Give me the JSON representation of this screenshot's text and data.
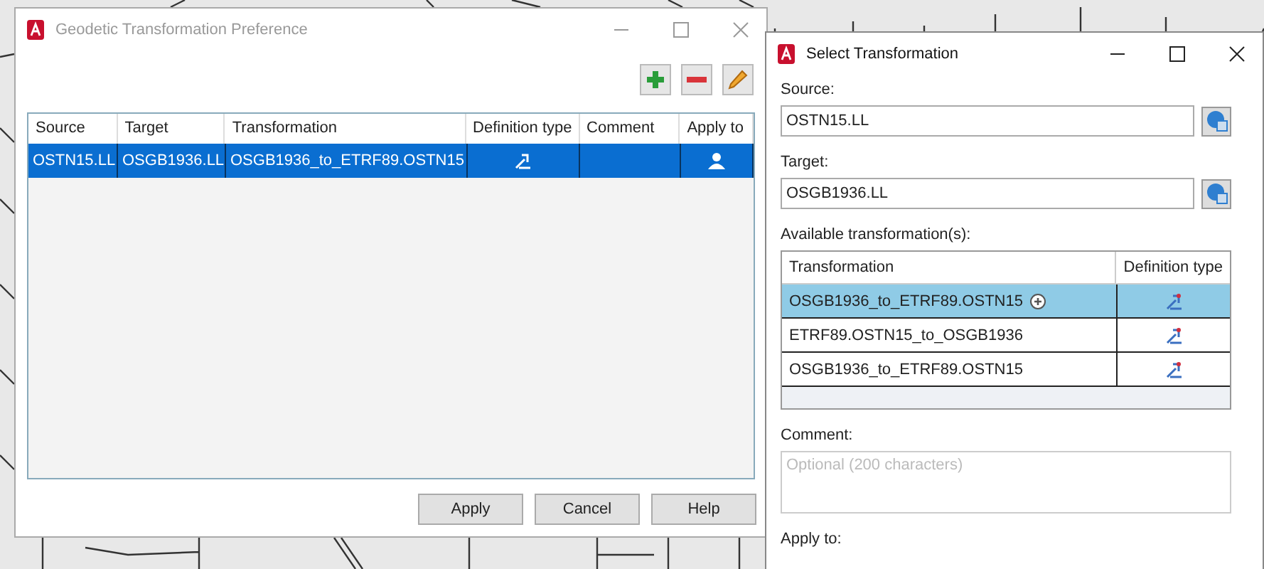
{
  "preference_window": {
    "title": "Geodetic Transformation Preference",
    "active": false,
    "columns": [
      "Source",
      "Target",
      "Transformation",
      "Definition type",
      "Comment",
      "Apply to"
    ],
    "rows": [
      {
        "source": "OSTN15.LL",
        "target": "OSGB1936.LL",
        "transformation": "OSGB1936_to_ETRF89.OSTN15",
        "selected": true
      }
    ],
    "buttons": [
      "Apply",
      "Cancel",
      "Help"
    ]
  },
  "select_window": {
    "title": "Select Transformation",
    "active": true,
    "source_label": "Source:",
    "source_value": "OSTN15.LL",
    "target_label": "Target:",
    "target_value": "OSGB1936.LL",
    "available_label": "Available transformation(s):",
    "columns": [
      "Transformation",
      "Definition type"
    ],
    "rows": [
      {
        "transformation": "OSGB1936_to_ETRF89.OSTN15",
        "selected": true,
        "preferred": true
      },
      {
        "transformation": "ETRF89.OSTN15_to_OSGB1936",
        "selected": false,
        "preferred": false
      },
      {
        "transformation": "OSGB1936_to_ETRF89.OSTN15",
        "selected": false,
        "preferred": false
      }
    ],
    "comment_label": "Comment:",
    "comment_placeholder": "Optional (200 characters)",
    "apply_label": "Apply to:"
  }
}
